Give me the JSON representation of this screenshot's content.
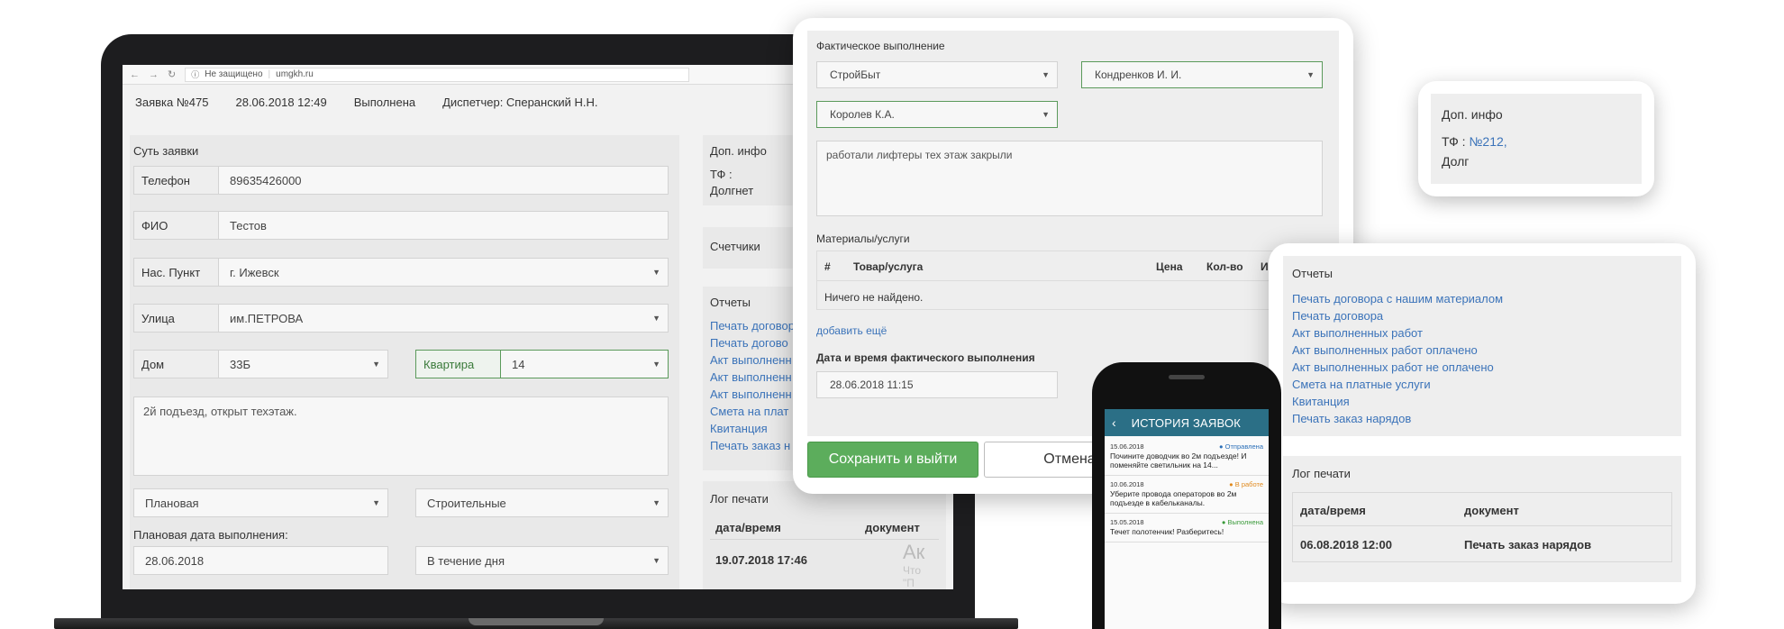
{
  "laptop": {
    "browser": {
      "security": "Не защищено",
      "url": "umgkh.ru"
    },
    "header": {
      "ticket": "Заявка №475",
      "datetime": "28.06.2018 12:49",
      "status": "Выполнена",
      "dispatcher": "Диспетчер: Сперанский Н.Н."
    },
    "form": {
      "section_title": "Суть заявки",
      "phone_label": "Телефон",
      "phone_value": "89635426000",
      "fio_label": "ФИО",
      "fio_value": "Тестов",
      "settlement_label": "Нас. Пункт",
      "settlement_value": "г. Ижевск",
      "street_label": "Улица",
      "street_value": "им.ПЕТРОВА",
      "house_label": "Дом",
      "house_value": "33Б",
      "flat_label": "Квартира",
      "flat_value": "14",
      "description": "2й подъезд, открыт техэтаж.",
      "type_value": "Плановая",
      "category_value": "Строительные",
      "planned_date_label": "Плановая дата выполнения:",
      "planned_date_value": "28.06.2018",
      "period_value": "В течение дня"
    },
    "side": {
      "info_title": "Доп. инфо",
      "tf_label": "ТФ :",
      "debt_label": "Долгнет",
      "counters_title": "Счетчики",
      "reports_title": "Отчеты",
      "reports": [
        "Печать договора",
        "Печать догово",
        "Акт выполненн",
        "Акт выполненн",
        "Акт выполненн",
        "Смета на плат",
        "Квитанция",
        "Печать заказ н"
      ],
      "log_title": "Лог печати",
      "log_col_datetime": "дата/время",
      "log_col_document": "документ",
      "log_row_datetime": "19.07.2018 17:46",
      "watermark": "Ак",
      "watermark2": "Что",
      "watermark3": "\"П"
    }
  },
  "modal": {
    "title": "Фактическое выполнение",
    "contractor": "СтройБыт",
    "executor1": "Кондренков И. И.",
    "executor2": "Королев К.А.",
    "comment": "работали лифтеры тех этаж закрыли",
    "materials_title": "Материалы/услуги",
    "col_num": "#",
    "col_item": "Товар/услуга",
    "col_price": "Цена",
    "col_qty": "Кол-во",
    "col_more": "И",
    "empty_text": "Ничего не найдено.",
    "add_more": "добавить ещё",
    "actual_dt_label": "Дата и время фактического выполнения",
    "actual_dt_value": "28.06.2018 11:15",
    "save_button": "Сохранить и выйти",
    "cancel_button": "Отмена"
  },
  "info_card": {
    "title": "Доп. инфо",
    "tf_label": "ТФ :",
    "tf_link": "№212,",
    "debt_label": "Долг"
  },
  "report_card": {
    "reports_title": "Отчеты",
    "reports": [
      "Печать договора с нашим материалом",
      "Печать договора",
      "Акт выполненных работ",
      "Акт выполненных работ оплачено",
      "Акт выполненных работ не оплачено",
      "Смета на платные услуги",
      "Квитанция",
      "Печать заказ нарядов"
    ],
    "log_title": "Лог печати",
    "log_col_datetime": "дата/время",
    "log_col_document": "документ",
    "log_row_datetime": "06.08.2018 12:00",
    "log_row_document": "Печать заказ нарядов"
  },
  "phone": {
    "title": "ИСТОРИЯ ЗАЯВОК",
    "back_icon": "chevron-left-icon",
    "items": [
      {
        "date": "15.06.2018",
        "status": "Отправлена",
        "status_color": "#2b6fb8",
        "text": "Почините доводчик во 2м подъезде! И поменяйте светильник на 14..."
      },
      {
        "date": "10.06.2018",
        "status": "В работе",
        "status_color": "#e08a1e",
        "text": "Уберите провода операторов во 2м подъезде в кабельканалы."
      },
      {
        "date": "15.05.2018",
        "status": "Выполнена",
        "status_color": "#3a9a3a",
        "text": "Течет полотенчик! Разберитесь!"
      }
    ]
  }
}
